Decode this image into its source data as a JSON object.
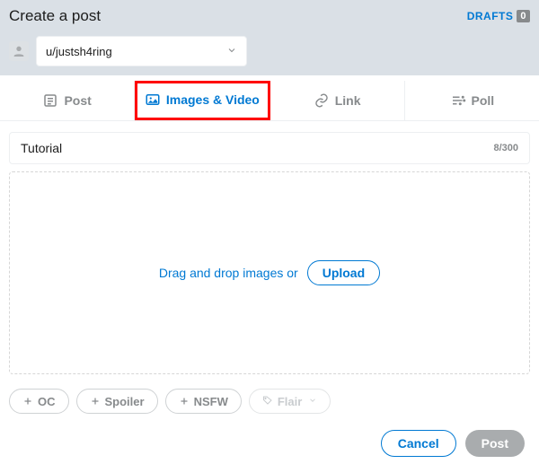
{
  "header": {
    "title": "Create a post",
    "drafts_label": "DRAFTS",
    "drafts_count": "0"
  },
  "community": {
    "name": "u/justsh4ring"
  },
  "tabs": {
    "post": "Post",
    "images": "Images & Video",
    "link": "Link",
    "poll": "Poll"
  },
  "title_field": {
    "value": "Tutorial",
    "counter": "8/300"
  },
  "dropzone": {
    "hint": "Drag and drop images or",
    "upload_label": "Upload"
  },
  "tags": {
    "oc": "OC",
    "spoiler": "Spoiler",
    "nsfw": "NSFW",
    "flair": "Flair"
  },
  "actions": {
    "cancel": "Cancel",
    "post": "Post"
  }
}
